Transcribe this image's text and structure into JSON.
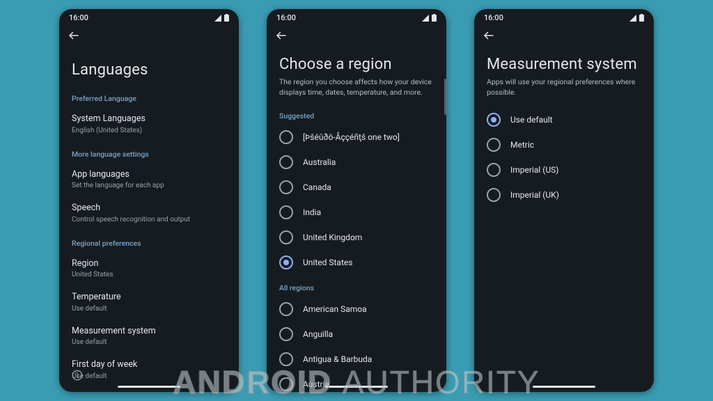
{
  "statusbar": {
    "time": "16:00"
  },
  "screen1": {
    "title": "Languages",
    "sections": {
      "preferred": {
        "header": "Preferred Language",
        "items": [
          {
            "title": "System Languages",
            "sub": "English (United States)"
          }
        ]
      },
      "more": {
        "header": "More language settings",
        "items": [
          {
            "title": "App languages",
            "sub": "Set the language for each app"
          },
          {
            "title": "Speech",
            "sub": "Control speech recognition and output"
          }
        ]
      },
      "regional": {
        "header": "Regional preferences",
        "items": [
          {
            "title": "Region",
            "sub": "United States"
          },
          {
            "title": "Temperature",
            "sub": "Use default"
          },
          {
            "title": "Measurement system",
            "sub": "Use default"
          },
          {
            "title": "First day of week",
            "sub": "Use default"
          }
        ]
      }
    }
  },
  "screen2": {
    "title": "Choose a region",
    "subtitle": "The region you choose affects how your device displays time, dates, temperature, and more.",
    "suggested": {
      "header": "Suggested",
      "items": [
        {
          "label": "[Þšéûðö-Åççéñţš one two]",
          "selected": false
        },
        {
          "label": "Australia",
          "selected": false
        },
        {
          "label": "Canada",
          "selected": false
        },
        {
          "label": "India",
          "selected": false
        },
        {
          "label": "United Kingdom",
          "selected": false
        },
        {
          "label": "United States",
          "selected": true
        }
      ]
    },
    "all": {
      "header": "All regions",
      "items": [
        {
          "label": "American Samoa",
          "selected": false
        },
        {
          "label": "Anguilla",
          "selected": false
        },
        {
          "label": "Antigua & Barbuda",
          "selected": false
        },
        {
          "label": "Austria",
          "selected": false
        }
      ]
    }
  },
  "screen3": {
    "title": "Measurement system",
    "subtitle": "Apps will use your regional preferences where possible.",
    "options": [
      {
        "label": "Use default",
        "selected": true
      },
      {
        "label": "Metric",
        "selected": false
      },
      {
        "label": "Imperial (US)",
        "selected": false
      },
      {
        "label": "Imperial (UK)",
        "selected": false
      }
    ]
  },
  "watermark": {
    "a": "ANDROID",
    "b": "AUTHORITY"
  }
}
